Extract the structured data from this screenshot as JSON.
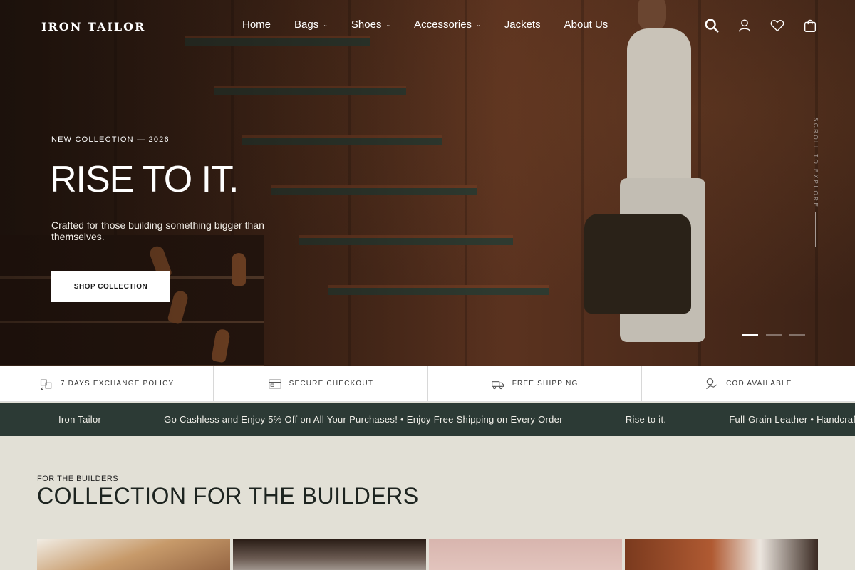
{
  "brand": {
    "logo": "IRON TAILOR"
  },
  "nav": {
    "items": [
      {
        "label": "Home",
        "has_dropdown": false
      },
      {
        "label": "Bags",
        "has_dropdown": true
      },
      {
        "label": "Shoes",
        "has_dropdown": true
      },
      {
        "label": "Accessories",
        "has_dropdown": true
      },
      {
        "label": "Jackets",
        "has_dropdown": false
      },
      {
        "label": "About Us",
        "has_dropdown": false
      }
    ],
    "dropdown_glyph": "⌄"
  },
  "header_icons": [
    "search-icon",
    "account-icon",
    "wishlist-icon",
    "cart-icon"
  ],
  "hero": {
    "eyebrow": "NEW COLLECTION — 2026",
    "headline": "RISE TO IT.",
    "subtext": "Crafted for those building something bigger than themselves.",
    "cta": "SHOP COLLECTION",
    "scroll_hint": "SCROLL TO EXPLORE",
    "slides": 3,
    "active_slide": 1
  },
  "features": [
    {
      "label": "7 DAYS EXCHANGE POLICY",
      "icon": "exchange-icon"
    },
    {
      "label": "SECURE CHECKOUT",
      "icon": "secure-checkout-icon"
    },
    {
      "label": "FREE SHIPPING",
      "icon": "shipping-truck-icon"
    },
    {
      "label": "COD AVAILABLE",
      "icon": "cash-on-delivery-icon"
    }
  ],
  "marquee": [
    "Iron Tailor",
    "Go Cashless and Enjoy 5% Off on All Your Purchases! • Enjoy Free Shipping on Every Order",
    "Rise to it.",
    "Full-Grain Leather • Handcraf"
  ],
  "collection": {
    "eyebrow": "FOR THE BUILDERS",
    "title": "COLLECTION FOR THE BUILDERS",
    "cards": 4
  },
  "colors": {
    "marquee_bg": "#2c3a35",
    "page_bg": "#e2e0d6",
    "hero_dark": "#3b2216"
  }
}
